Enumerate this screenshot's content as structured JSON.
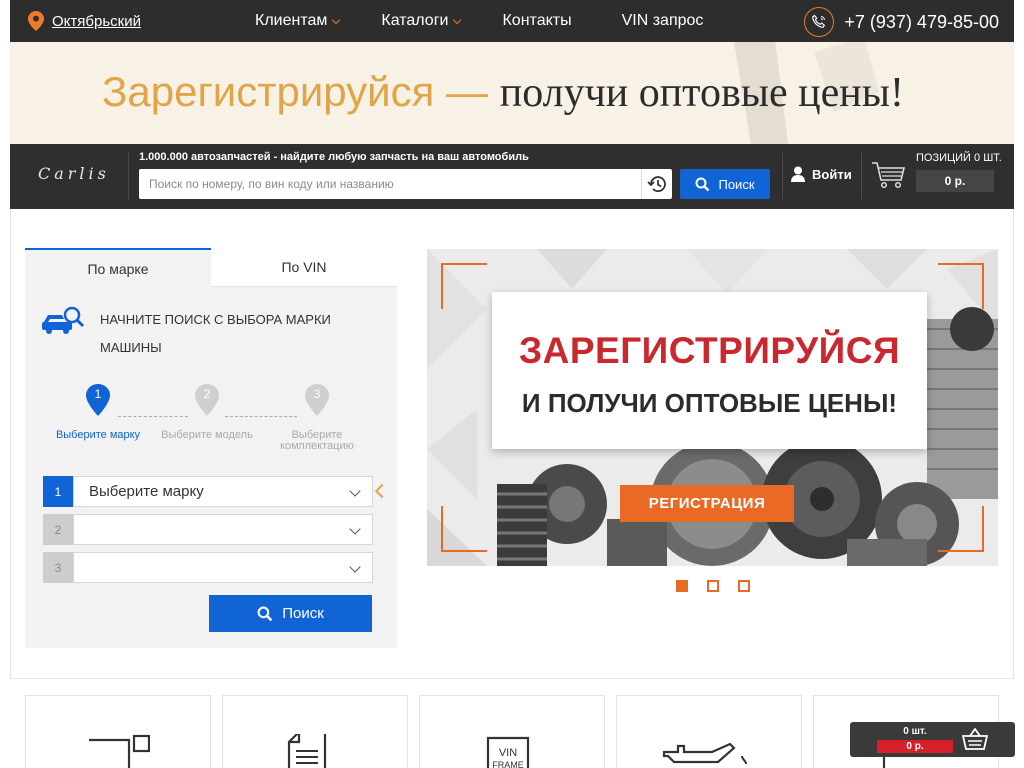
{
  "topbar": {
    "location": "Октябрьский",
    "nav": [
      {
        "label": "Клиентам",
        "dropdown": true
      },
      {
        "label": "Каталоги",
        "dropdown": true
      },
      {
        "label": "Контакты",
        "dropdown": false
      },
      {
        "label": "VIN запрос",
        "dropdown": false
      }
    ],
    "phone": "+7 (937) 479-85-00"
  },
  "promo": {
    "part_a": "Зарегистрируйся —",
    "part_b": "получи оптовые цены!"
  },
  "header": {
    "logo": "Carlis",
    "tagline": "1.000.000 автозапчастей - найдите любую запчасть на ваш автомобиль",
    "search_placeholder": "Поиск по номеру, по вин коду или названию",
    "search_button": "Поиск",
    "login": "Войти",
    "cart_positions": "ПОЗИЦИЙ 0 ШТ.",
    "cart_sum": "0 р."
  },
  "panel": {
    "tabs": [
      "По марке",
      "По VIN"
    ],
    "hint": "НАЧНИТЕ ПОИСК С ВЫБОРА МАРКИ МАШИНЫ",
    "steps": [
      {
        "num": "1",
        "label": "Выберите марку"
      },
      {
        "num": "2",
        "label": "Выберите модель"
      },
      {
        "num": "3",
        "label": "Выберите комплектацию"
      }
    ],
    "selects": [
      {
        "num": "1",
        "value": "Выберите марку"
      },
      {
        "num": "2",
        "value": ""
      },
      {
        "num": "3",
        "value": ""
      }
    ],
    "search_button": "Поиск"
  },
  "slider": {
    "line1": "ЗАРЕГИСТРИРУЙСЯ",
    "line2": "И ПОЛУЧИ ОПТОВЫЕ ЦЕНЫ!",
    "button": "РЕГИСТРАЦИЯ",
    "dots": 3,
    "active_dot": 0
  },
  "cards": [
    {
      "icon": "document-corner-icon"
    },
    {
      "icon": "document-text-icon"
    },
    {
      "icon": "vin-frame-icon"
    },
    {
      "icon": "oil-can-icon"
    },
    {
      "icon": "parts-icon"
    }
  ],
  "floating_cart": {
    "count": "0 шт.",
    "sum": "0 р."
  },
  "colors": {
    "accent_orange": "#ea6a25",
    "brand_blue": "#1064d6",
    "promo_gold": "#e1a446",
    "promo_red": "#c8282e",
    "topbar_dark": "#2d2d2d"
  }
}
